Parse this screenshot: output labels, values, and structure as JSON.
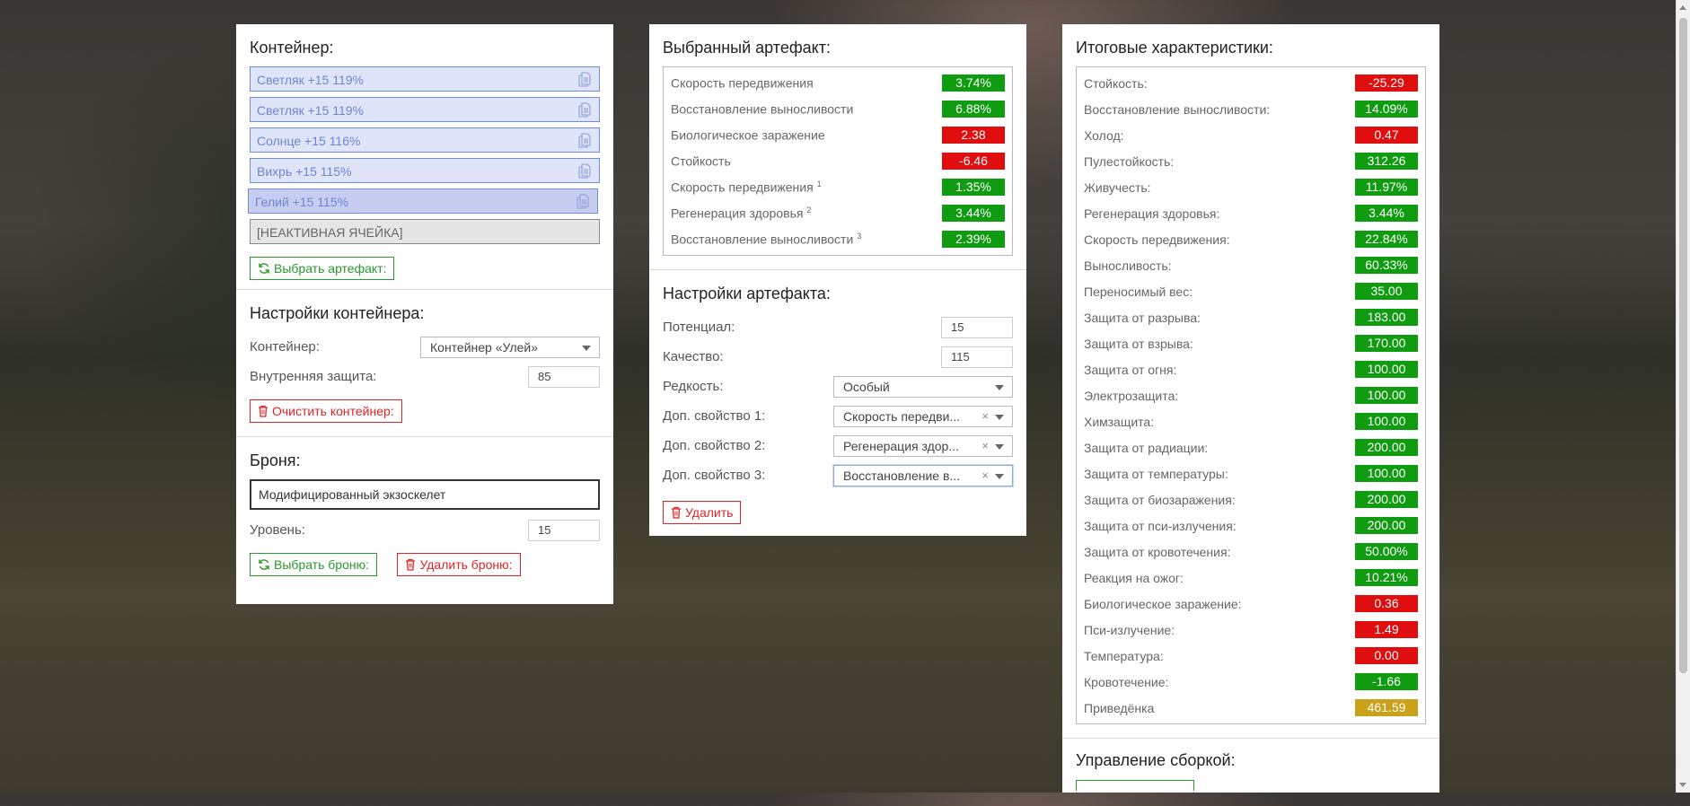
{
  "container_panel": {
    "title": "Контейнер:",
    "slots": [
      {
        "label": "Светляк +15 119%"
      },
      {
        "label": "Светляк +15 119%"
      },
      {
        "label": "Солнце +15 116%"
      },
      {
        "label": "Вихрь +15 115%"
      },
      {
        "label": "Гелий +15 115%"
      }
    ],
    "inactive_slot": "[НЕАКТИВНАЯ ЯЧЕЙКА]",
    "choose_artifact_button": "Выбрать артефакт:"
  },
  "container_settings": {
    "title": "Настройки контейнера:",
    "container_label": "Контейнер:",
    "container_value": "Контейнер «Улей»",
    "inner_protection_label": "Внутренняя защита:",
    "inner_protection_value": "85",
    "clear_button": "Очистить контейнер:"
  },
  "armor": {
    "title": "Броня:",
    "armor_value": "Модифицированный экзоскелет",
    "level_label": "Уровень:",
    "level_value": "15",
    "choose_button": "Выбрать броню:",
    "delete_button": "Удалить броню:"
  },
  "selected_artifact": {
    "title": "Выбранный артефакт:",
    "stats": [
      {
        "name": "Скорость передвижения",
        "sup": "",
        "value": "3.74%",
        "color": "g"
      },
      {
        "name": "Восстановление выносливости",
        "sup": "",
        "value": "6.88%",
        "color": "g"
      },
      {
        "name": "Биологическое заражение",
        "sup": "",
        "value": "2.38",
        "color": "r"
      },
      {
        "name": "Стойкость",
        "sup": "",
        "value": "-6.46",
        "color": "r"
      },
      {
        "name": "Скорость передвижения",
        "sup": "1",
        "value": "1.35%",
        "color": "g"
      },
      {
        "name": "Регенерация здоровья",
        "sup": "2",
        "value": "3.44%",
        "color": "g"
      },
      {
        "name": "Восстановление выносливости",
        "sup": "3",
        "value": "2.39%",
        "color": "g"
      }
    ]
  },
  "artifact_settings": {
    "title": "Настройки артефакта:",
    "potential_label": "Потенциал:",
    "potential_value": "15",
    "quality_label": "Качество:",
    "quality_value": "115",
    "rarity_label": "Редкость:",
    "rarity_value": "Особый",
    "prop1_label": "Доп. свойство 1:",
    "prop1_value": "Скорость передви...",
    "prop2_label": "Доп. свойство 2:",
    "prop2_value": "Регенерация здор...",
    "prop3_label": "Доп. свойство 3:",
    "prop3_value": "Восстановление в...",
    "clear_symbol": "×",
    "delete_button": "Удалить"
  },
  "total_stats": {
    "title": "Итоговые характеристики:",
    "stats": [
      {
        "name": "Стойкость:",
        "value": "-25.29",
        "color": "r"
      },
      {
        "name": "Восстановление выносливости:",
        "value": "14.09%",
        "color": "g"
      },
      {
        "name": "Холод:",
        "value": "0.47",
        "color": "r"
      },
      {
        "name": "Пулестойкость:",
        "value": "312.26",
        "color": "g"
      },
      {
        "name": "Живучесть:",
        "value": "11.97%",
        "color": "g"
      },
      {
        "name": "Регенерация здоровья:",
        "value": "3.44%",
        "color": "g"
      },
      {
        "name": "Скорость передвижения:",
        "value": "22.84%",
        "color": "g"
      },
      {
        "name": "Выносливость:",
        "value": "60.33%",
        "color": "g"
      },
      {
        "name": "Переносимый вес:",
        "value": "35.00",
        "color": "g"
      },
      {
        "name": "Защита от разрыва:",
        "value": "183.00",
        "color": "g"
      },
      {
        "name": "Защита от взрыва:",
        "value": "170.00",
        "color": "g"
      },
      {
        "name": "Защита от огня:",
        "value": "100.00",
        "color": "g"
      },
      {
        "name": "Электрозащита:",
        "value": "100.00",
        "color": "g"
      },
      {
        "name": "Химзащита:",
        "value": "100.00",
        "color": "g"
      },
      {
        "name": "Защита от радиации:",
        "value": "200.00",
        "color": "g"
      },
      {
        "name": "Защита от температуры:",
        "value": "100.00",
        "color": "g"
      },
      {
        "name": "Защита от биозаражения:",
        "value": "200.00",
        "color": "g"
      },
      {
        "name": "Защита от пси-излучения:",
        "value": "200.00",
        "color": "g"
      },
      {
        "name": "Защита от кровотечения:",
        "value": "50.00%",
        "color": "g"
      },
      {
        "name": "Реакция на ожог:",
        "value": "10.21%",
        "color": "g"
      },
      {
        "name": "Биологическое заражение:",
        "value": "0.36",
        "color": "r"
      },
      {
        "name": "Пси-излучение:",
        "value": "1.49",
        "color": "r"
      },
      {
        "name": "Температура:",
        "value": "0.00",
        "color": "r"
      },
      {
        "name": "Кровотечение:",
        "value": "-1.66",
        "color": "g"
      },
      {
        "name": "Приведёнка",
        "value": "461.59",
        "color": "y"
      }
    ]
  },
  "build_management": {
    "title": "Управление сборкой:"
  }
}
